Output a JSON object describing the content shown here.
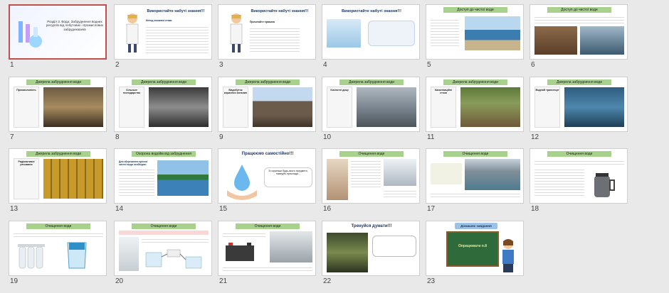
{
  "slides": [
    {
      "num": "1",
      "title": "Розділ 3. Вода. Забруднення водних ресурсів від побутових і промислових забруднювачів"
    },
    {
      "num": "2",
      "title": "Використайте набуті знання!!!",
      "subtitle": "Метод мозкової атаки"
    },
    {
      "num": "3",
      "title": "Використайте набуті знання!!!",
      "subtitle": "Прочитайте правила"
    },
    {
      "num": "4",
      "title": "Використайте набуті знання!!!"
    },
    {
      "num": "5",
      "band": "Доступ до чистої води"
    },
    {
      "num": "6",
      "band": "Доступ до чистої води"
    },
    {
      "num": "7",
      "band": "Джерела забруднення води",
      "label": "Промисловість"
    },
    {
      "num": "8",
      "band": "Джерела забруднення води",
      "label": "Сільське господарство"
    },
    {
      "num": "9",
      "band": "Джерела забруднення води",
      "label": "Видобуток корисних копалин"
    },
    {
      "num": "10",
      "band": "Джерела забруднення води",
      "label": "Кислотні дощі"
    },
    {
      "num": "11",
      "band": "Джерела забруднення води",
      "label": "Каналізаційні стоки"
    },
    {
      "num": "12",
      "band": "Джерела забруднення води",
      "label": "Водний транспорт"
    },
    {
      "num": "13",
      "band": "Джерела забруднення води",
      "label": "Радіоактивні речовини"
    },
    {
      "num": "14",
      "band": "Охорона водойм від забруднення",
      "label": "Для збереження прісної чистої води необхідно:"
    },
    {
      "num": "15",
      "title": "Працюємо самостійно!!!",
      "note": "Зі скриньки будь-якого предмета, наведіть приклади..."
    },
    {
      "num": "16",
      "band": "Очищення води"
    },
    {
      "num": "17",
      "band": "Очищення води"
    },
    {
      "num": "18",
      "band": "Очищення води"
    },
    {
      "num": "19",
      "band": "Очищення води"
    },
    {
      "num": "20",
      "band": "Очищення води"
    },
    {
      "num": "21",
      "band": "Очищення води"
    },
    {
      "num": "22",
      "title": "Тренуйся думати!!!"
    },
    {
      "num": "23",
      "title": "Домашнє завдання",
      "board": "Опрацювати п.8"
    }
  ],
  "colors": {
    "accent_band": "#a9d18e",
    "selection": "#c0504d"
  }
}
